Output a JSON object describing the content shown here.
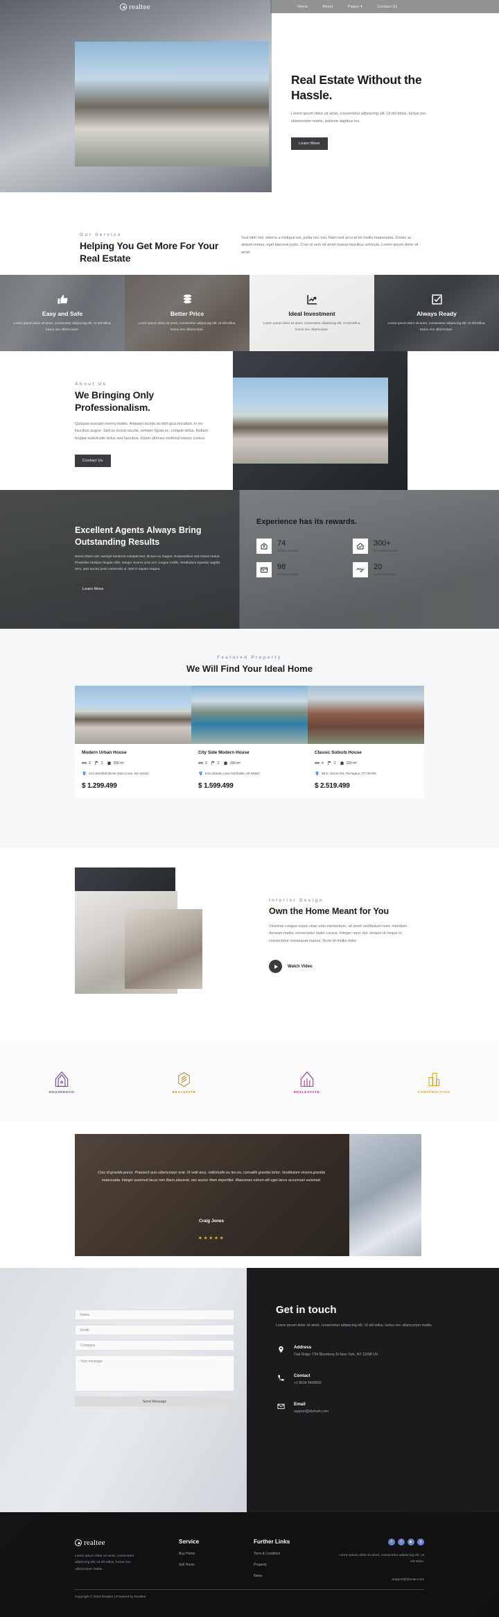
{
  "brand": {
    "name": "realtee",
    "logo_icon": "house-circle-logo"
  },
  "nav": {
    "items": [
      {
        "label": "Home",
        "icon": ""
      },
      {
        "label": "About",
        "icon": ""
      },
      {
        "label": "Pages",
        "icon": "chevron-down-icon"
      },
      {
        "label": "Contact Us",
        "icon": ""
      }
    ]
  },
  "hero": {
    "title": "Real Estate Without the Hassle.",
    "paragraph": "Lorem ipsum dolor sit amet, consectetur adipiscing elit. Ut elit tellus, luctus nec ullamcorper mattis, pulvinar dapibus leo.",
    "cta": "Learn More",
    "image_alt": "modern-house-exterior"
  },
  "service_head": {
    "eyebrow": "Our Service",
    "title": "Helping You Get More For Your Real Estate",
    "paragraph": "Sed nibh nisl, viverra a tristique vel, porta nec nisi. Nam sed arcu at mi mollis malesuada. Donec ac aliquet metus, eget placerat justo. Cras ut sem sit amet massa faucibus vehicula. Lorem ipsum dolor sit amet."
  },
  "service_cards": [
    {
      "title": "Easy and Safe",
      "desc": "Lorem ipsum dolor sit amet, consectetur adipiscing elit. Ut elit tellus, luctus nec ullamcorper.",
      "icon": "thumbs-up-icon",
      "theme": "dark",
      "bg": "ph-contract"
    },
    {
      "title": "Better Price",
      "desc": "Lorem ipsum dolor sit amet, consectetur adipiscing elit. Ut elit tellus, luctus nec ullamcorper.",
      "icon": "coins-icon",
      "theme": "dark",
      "bg": "ph-coins"
    },
    {
      "title": "Ideal Investment",
      "desc": "Lorem ipsum dolor sit amet, consectetur adipiscing elit. Ut elit tellus, luctus nec ullamcorper.",
      "icon": "chart-growth-icon",
      "theme": "light",
      "bg": "ph-model"
    },
    {
      "title": "Always Ready",
      "desc": "Lorem ipsum dolor sit amet, consectetur adipiscing elit. Ut elit tellus, luctus nec ullamcorper.",
      "icon": "check-square-icon",
      "theme": "dark",
      "bg": "ph-desk"
    }
  ],
  "about": {
    "eyebrow": "About Us",
    "title": "We Bringing Only Professionalism.",
    "paragraph": "Quisque suscipit viverra mattis. Aliquam lacinia at nibh quis tincidunt. In eu faucibus augue. Sed ac lectus iaculis, semper ligula ac, congue tellus. Nullam feugiat sollicitudin tellus sed faucibus. Etiam ultricies eleifend mauris cursus.",
    "cta": "Contact Us",
    "image_alt": "modern-villa-with-lawn"
  },
  "agents": {
    "title": "Excellent Agents Always Bring Outstanding Results",
    "paragraph": "Donec libero est, suscipit hendrerit volutpat sed, dictum eu magna. Suspendisse sed metus metus. Phasellus tristique feugiat nibh, integer viverra urna non congue mollis. Vestibulum egestas sagittis sem, quis auctor justo commodo ut. Sed in sapien magna.",
    "cta": "Learn More",
    "stats_title": "Experience has its rewards.",
    "stats": [
      {
        "value": "74",
        "label": "Home on Sale",
        "icon": "home-dollar-icon"
      },
      {
        "value": "300+",
        "label": "Managed House",
        "icon": "home-check-icon"
      },
      {
        "value": "98",
        "label": "Rented Home",
        "icon": "home-key-icon"
      },
      {
        "value": "20",
        "label": "Escrow Service",
        "icon": "handshake-icon"
      }
    ]
  },
  "featured": {
    "eyebrow": "Featured Property",
    "title": "We Will Find Your Ideal Home",
    "properties": [
      {
        "name": "Modern Urban House",
        "beds": "3",
        "baths": "3",
        "area": "200 m²",
        "address": "213 Windfall Street Glen Cove, NY 11542",
        "price": "$ 1.299.499",
        "bg": "ph-house1"
      },
      {
        "name": "City Side Modern House",
        "beds": "3",
        "baths": "2",
        "area": "150 m²",
        "address": "616 Atlantic Lane Northville, MI 48167",
        "price": "$ 1.599.499",
        "bg": "ph-pool"
      },
      {
        "name": "Classic Suburb House",
        "beds": "4",
        "baths": "2",
        "area": "220 m²",
        "address": "88 E. Shore Rd. Torrington, CT 06790",
        "price": "$ 2.519.499",
        "bg": "ph-brick"
      }
    ]
  },
  "interior": {
    "eyebrow": "Interior Design",
    "title": "Own the Home Meant for You",
    "paragraph": "Vivamus congue turpis vitae odio elementum, sit amet vestibulum nunc interdum. Aenean mattis consectetur nislet cursus. Integer nunc dui, tempor id neque in, consectetur consequat massa. Nunc id mollis dolor.",
    "watch_label": "Watch Video"
  },
  "brands": [
    {
      "name": "HOUSEDECO",
      "icon": "house-outline-logo",
      "color": "#6b3fa0"
    },
    {
      "name": "REALSTATE",
      "icon": "hex-layers-logo",
      "color": "#c08a1e"
    },
    {
      "name": "REALESTATE",
      "icon": "house-lines-logo",
      "color": "#a8338c"
    },
    {
      "name": "CONSTRUCTION",
      "icon": "buildings-logo",
      "color": "#d9a021"
    }
  ],
  "testimonial": {
    "quote": "Cras id gravida purus. Praesent quis ullamcorper erat. Ut velit arcu, sollicitudin eu leo eu, convallis gravida tortor. Vestibulum viverra gravida malesuada. Integer euismod lacus non libero placerat, nec auctor diam imperdiet. Maecenas rutrum elit eget lacus accumsan euismod.",
    "author": "Craig Jones",
    "rating": "★★★★★"
  },
  "contact": {
    "form": {
      "name_placeholder": "Name",
      "email_placeholder": "Email",
      "company_placeholder": "Company",
      "message_placeholder": "Your message",
      "submit_label": "Send Message"
    },
    "title": "Get in touch",
    "paragraph": "Lorem ipsum dolor sit amet, consectetur adipiscing elit. Ut elit tellus, luctus nec ullamcorper mattis.",
    "blocks": [
      {
        "title": "Address",
        "value": "Oak Ridge 77th Blumberg St New York, NY 11098 US",
        "icon": "map-pin-icon"
      },
      {
        "title": "Contact",
        "value": "+1 8634 5400892",
        "icon": "phone-icon"
      },
      {
        "title": "Email",
        "value": "support@domain.com",
        "icon": "envelope-icon"
      }
    ]
  },
  "footer": {
    "brand": "realtee",
    "about": "Lorem ipsum dolor sit amet, consectetur adipiscing elit. Ut elit tellus, luctus nec ullamcorper mattis.",
    "col_service": {
      "title": "Service",
      "items": [
        "Buy Home",
        "Sell Home"
      ]
    },
    "col_links": {
      "title": "Further Links",
      "items": [
        "Term & Condition",
        "Property",
        "News"
      ]
    },
    "socials": [
      {
        "name": "facebook-icon",
        "glyph": "f"
      },
      {
        "name": "twitter-icon",
        "glyph": "t"
      },
      {
        "name": "youtube-icon",
        "glyph": "▶"
      },
      {
        "name": "pinterest-icon",
        "glyph": "p"
      }
    ],
    "right_text": "Lorem ipsum dolor sit amet, consectetur adipiscing elit. Ut elit tellus.",
    "email": "Support@domain.com",
    "copyright": "Copyright © 2024 Realtee | Powered by Realtee"
  },
  "colors": {
    "accent_eyebrow": "#8ea0bb",
    "dark": "#1b1b1d",
    "button": "#3a3a3f",
    "star": "#e8a33d",
    "social": "#6f83c8"
  }
}
